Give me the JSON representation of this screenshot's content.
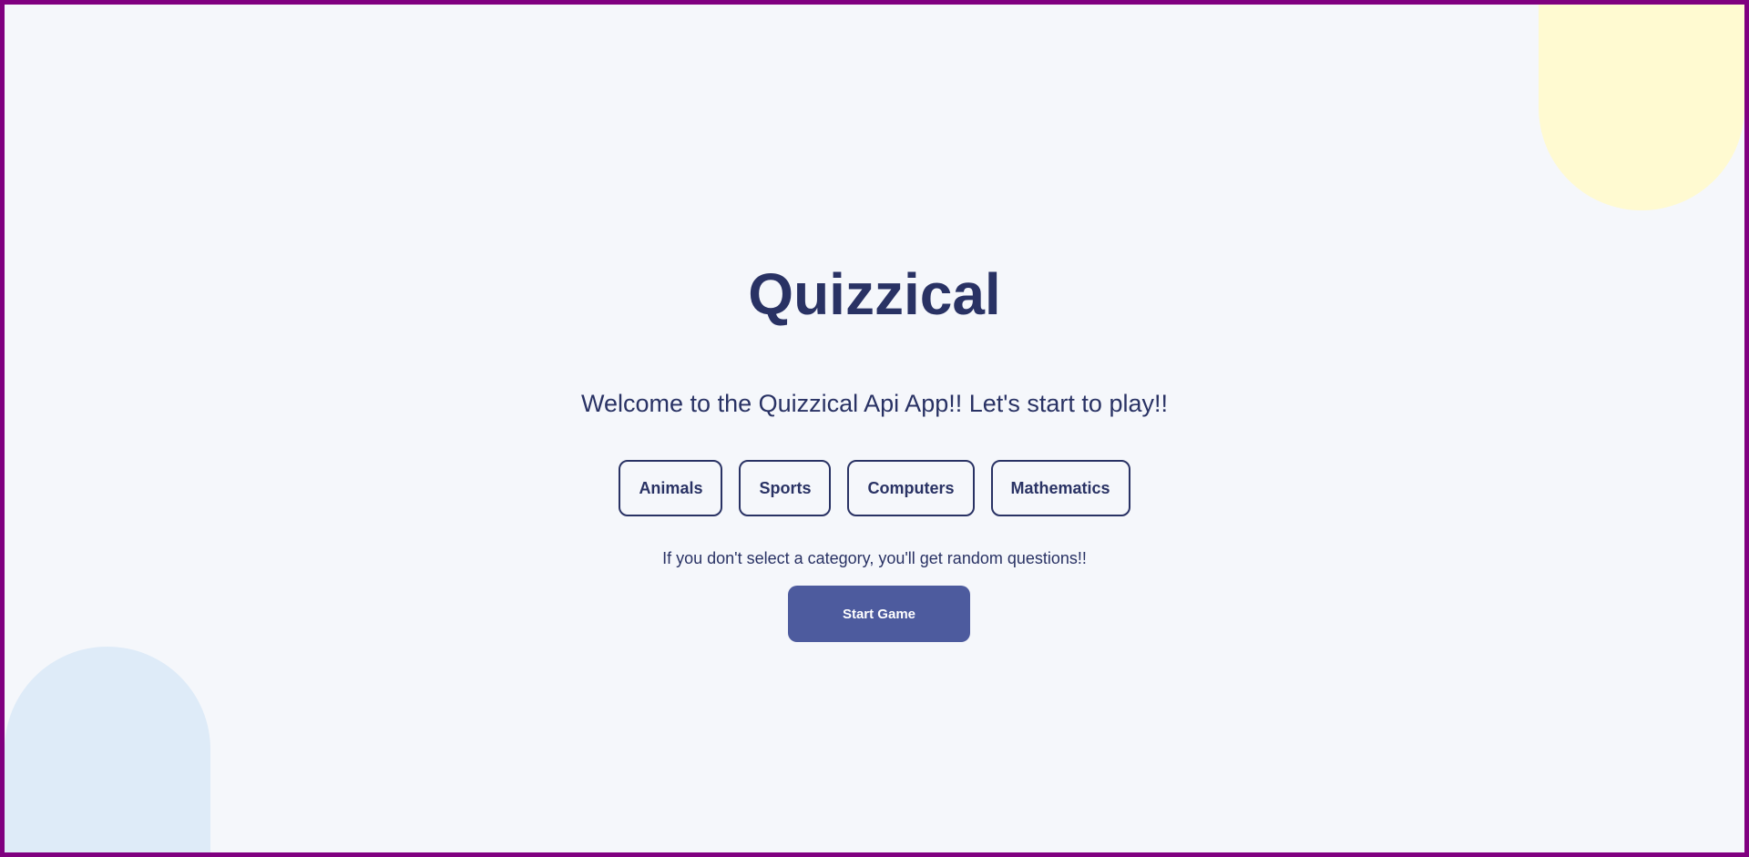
{
  "app": {
    "title": "Quizzical",
    "welcome": "Welcome to the Quizzical Api App!! Let's start to play!!",
    "hint": "If you don't select a category, you'll get random questions!!",
    "start_label": "Start Game"
  },
  "categories": [
    {
      "label": "Animals"
    },
    {
      "label": "Sports"
    },
    {
      "label": "Computers"
    },
    {
      "label": "Mathematics"
    }
  ],
  "colors": {
    "frame_border": "#800080",
    "background": "#F5F7FB",
    "text_primary": "#293264",
    "button_primary": "#4D5B9E",
    "blob_yellow": "#FFFAD1",
    "blob_blue": "#DEEBF8"
  }
}
